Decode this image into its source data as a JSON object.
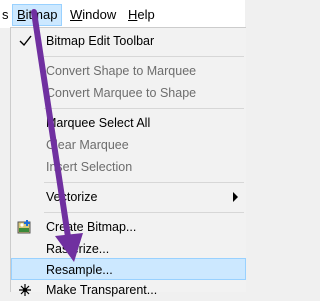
{
  "menubar": {
    "partial_left": "s",
    "items": [
      {
        "label": "Bitmap",
        "underline": "B",
        "rest": "itmap"
      },
      {
        "label": "Window",
        "underline": "W",
        "rest": "indow"
      },
      {
        "label": "Help",
        "underline": "H",
        "rest": "elp"
      }
    ]
  },
  "menu": {
    "items": [
      {
        "label": "Bitmap Edit Toolbar",
        "checked": true
      },
      {
        "label": "Convert Shape to Marquee",
        "disabled": true
      },
      {
        "label": "Convert Marquee to Shape",
        "disabled": true
      },
      {
        "label": "Marquee Select All"
      },
      {
        "label": "Clear Marquee",
        "disabled": true
      },
      {
        "label": "Insert Selection",
        "disabled": true
      },
      {
        "label": "Vectorize",
        "submenu": true
      },
      {
        "label": "Create Bitmap...",
        "icon": "create-bitmap-icon"
      },
      {
        "label": "Rasterize..."
      },
      {
        "label": "Resample...",
        "highlighted": true
      },
      {
        "label": "Make Transparent...",
        "icon": "make-transparent-icon"
      }
    ]
  },
  "colors": {
    "highlight": "#cce8ff",
    "highlight_border": "#99d1ff",
    "annotation_arrow": "#7030a0"
  }
}
